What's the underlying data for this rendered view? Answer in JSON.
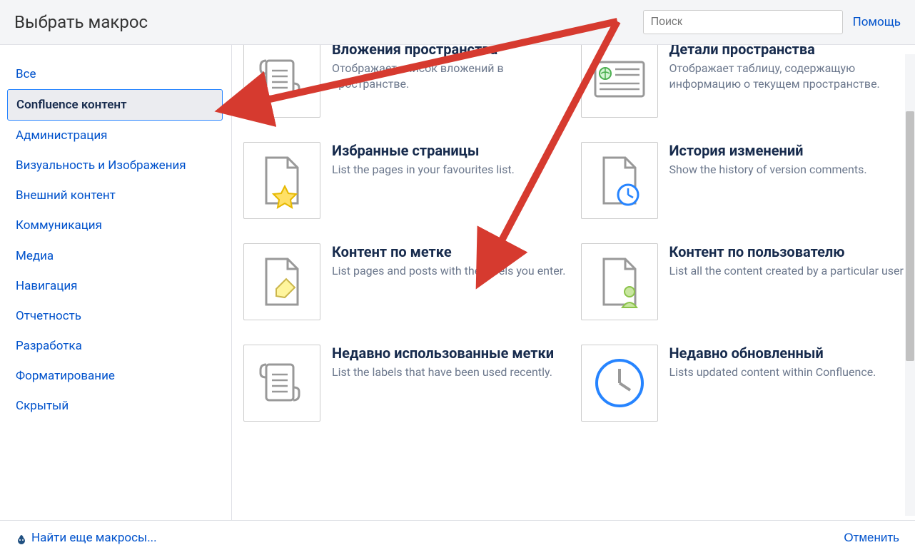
{
  "header": {
    "title": "Выбрать макрос",
    "search_placeholder": "Поиск",
    "help_label": "Помощь"
  },
  "sidebar": {
    "items": [
      {
        "label": "Все",
        "selected": false
      },
      {
        "label": "Confluence контент",
        "selected": true
      },
      {
        "label": "Администрация",
        "selected": false
      },
      {
        "label": "Визуальность и Изображения",
        "selected": false
      },
      {
        "label": "Внешний контент",
        "selected": false
      },
      {
        "label": "Коммуникация",
        "selected": false
      },
      {
        "label": "Медиа",
        "selected": false
      },
      {
        "label": "Навигация",
        "selected": false
      },
      {
        "label": "Отчетность",
        "selected": false
      },
      {
        "label": "Разработка",
        "selected": false
      },
      {
        "label": "Форматирование",
        "selected": false
      },
      {
        "label": "Скрытый",
        "selected": false
      }
    ]
  },
  "macros": [
    {
      "title": "Вложения пространства",
      "desc": "Отображает список вложений в пространстве.",
      "icon": "scroll"
    },
    {
      "title": "Детали пространства",
      "desc": "Отображает таблицу, содержащую информацию о текущем пространстве.",
      "icon": "globe-list"
    },
    {
      "title": "Избранные страницы",
      "desc": "List the pages in your favourites list.",
      "icon": "page-star"
    },
    {
      "title": "История изменений",
      "desc": "Show the history of version comments.",
      "icon": "page-clock"
    },
    {
      "title": "Контент по метке",
      "desc": "List pages and posts with the labels you enter.",
      "icon": "page-tag"
    },
    {
      "title": "Контент по пользователю",
      "desc": "List all the content created by a particular user",
      "icon": "page-user"
    },
    {
      "title": "Недавно использованные метки",
      "desc": "List the labels that have been used recently.",
      "icon": "scroll"
    },
    {
      "title": "Недавно обновленный",
      "desc": "Lists updated content within Confluence.",
      "icon": "clock"
    }
  ],
  "footer": {
    "find_more": "Найти еще макросы...",
    "cancel": "Отменить"
  }
}
